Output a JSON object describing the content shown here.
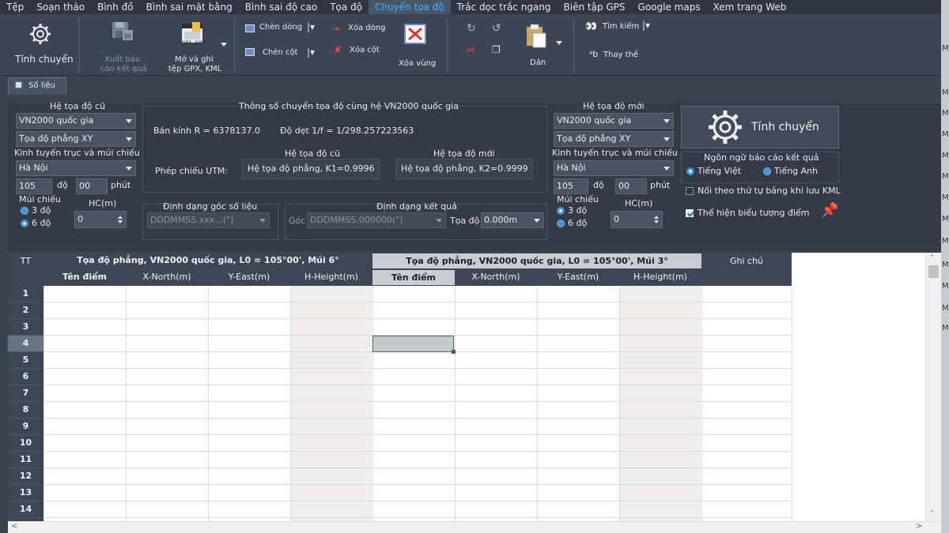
{
  "menu": [
    "Tệp",
    "Soạn thảo",
    "Bình đồ",
    "Bình sai mặt bằng",
    "Bình sai độ cao",
    "Tọa độ",
    "Chuyển tọa độ",
    "Trắc dọc trắc ngang",
    "Biên tập GPS",
    "Google maps",
    "Xem trang Web"
  ],
  "menu_active": "Chuyển tọa độ",
  "ribbon": {
    "calc": "Tính chuyển",
    "export_line1": "Xuất báo",
    "export_line2": "cáo kết quả",
    "gpx_line1": "Mở và ghi",
    "gpx_line2": "tệp GPX, KML",
    "gpx_icon_text": "GPX, KML",
    "insert_row": "Chèn dòng",
    "insert_col": "Chèn cột",
    "delete_row": "Xóa dòng",
    "delete_col": "Xóa cột",
    "delete_region": "Xóa vùng",
    "paste": "Dán",
    "find": "Tìm kiếm",
    "replace": "Thay thế"
  },
  "subtab": "Số liệu",
  "old_system": {
    "title": "Hệ tọa độ cũ",
    "datum": "VN2000 quốc gia",
    "coord_type": "Tọa độ phẳng XY",
    "meridian_label": "Kinh tuyến trục và múi chiếu",
    "province": "Hà Nội",
    "degree": "105",
    "degree_unit": "độ",
    "minute": "00",
    "minute_unit": "phút",
    "zone_label": "Múi chiếu",
    "zone_3": "3 độ",
    "zone_6": "6 độ",
    "zone_selected": "6 độ",
    "hc_label": "HC(m)",
    "hc_value": "0"
  },
  "params": {
    "title": "Thông số chuyển tọa độ cùng hệ VN2000 quốc gia",
    "radius": "Bán kính R = 6378137.0",
    "flattening": "Độ dẹt 1/f = 1/298.257223563",
    "old_label": "Hệ tọa độ cũ",
    "new_label": "Hệ tọa độ mới",
    "projection_label": "Phép chiếu UTM:",
    "old_proj": "Hệ tọa độ phẳng, K1=0.9996",
    "new_proj": "Hệ tọa độ phẳng, K2=0.9999"
  },
  "formats": {
    "angle_title": "Định dạng góc số liệu",
    "angle_value": "DDDMMSS.xxx...(\")",
    "result_title": "Định dạng kết quả",
    "result_angle_label": "Góc",
    "result_angle_value": "DDDMMSS.000000(\")",
    "result_coord_label": "Tọa độ",
    "result_coord_value": "0.000m"
  },
  "new_system": {
    "title": "Hệ tọa độ mới",
    "datum": "VN2000 quốc gia",
    "coord_type": "Tọa độ phẳng XY",
    "meridian_label": "Kinh tuyến trục và múi chiếu",
    "province": "Hà Nội",
    "degree": "105",
    "degree_unit": "độ",
    "minute": "00",
    "minute_unit": "phút",
    "zone_label": "Múi chiếu",
    "zone_3": "3 độ",
    "zone_6": "6 độ",
    "zone_selected": "3 độ",
    "hc_label": "HC(m)",
    "hc_value": "0"
  },
  "calc_button": "Tính chuyển",
  "report_language": {
    "title": "Ngôn ngữ báo cáo kết quả",
    "vietnamese": "Tiếng Việt",
    "english": "Tiếng Anh",
    "selected": "Tiếng Việt"
  },
  "options": {
    "kml_order": "Nối theo thứ tự bảng khi lưu KML",
    "kml_order_checked": false,
    "show_points": "Thể hiện biểu tượng điểm",
    "show_points_checked": true
  },
  "grid": {
    "tt_header": "TT",
    "group_left": "Tọa độ phẳng, VN2000 quốc gia, L0  = 105°00', Múi 6°",
    "group_right": "Tọa độ phẳng, VN2000 quốc gia, L0  = 105°00', Múi 3°",
    "note_header": "Ghi chú",
    "columns_left": [
      "Tên điểm",
      "X-North(m)",
      "Y-East(m)",
      "H-Height(m)"
    ],
    "columns_right": [
      "Tên điểm",
      "X-North(m)",
      "Y-East(m)",
      "H-Height(m)"
    ],
    "rows": [
      "1",
      "2",
      "3",
      "4",
      "5",
      "6",
      "7",
      "8",
      "9",
      "10",
      "11",
      "12",
      "13",
      "14"
    ],
    "current_row": "4"
  },
  "colors": {
    "accent": "#35b6ff",
    "background": "#3b4351",
    "radio": "#3f95d8"
  }
}
